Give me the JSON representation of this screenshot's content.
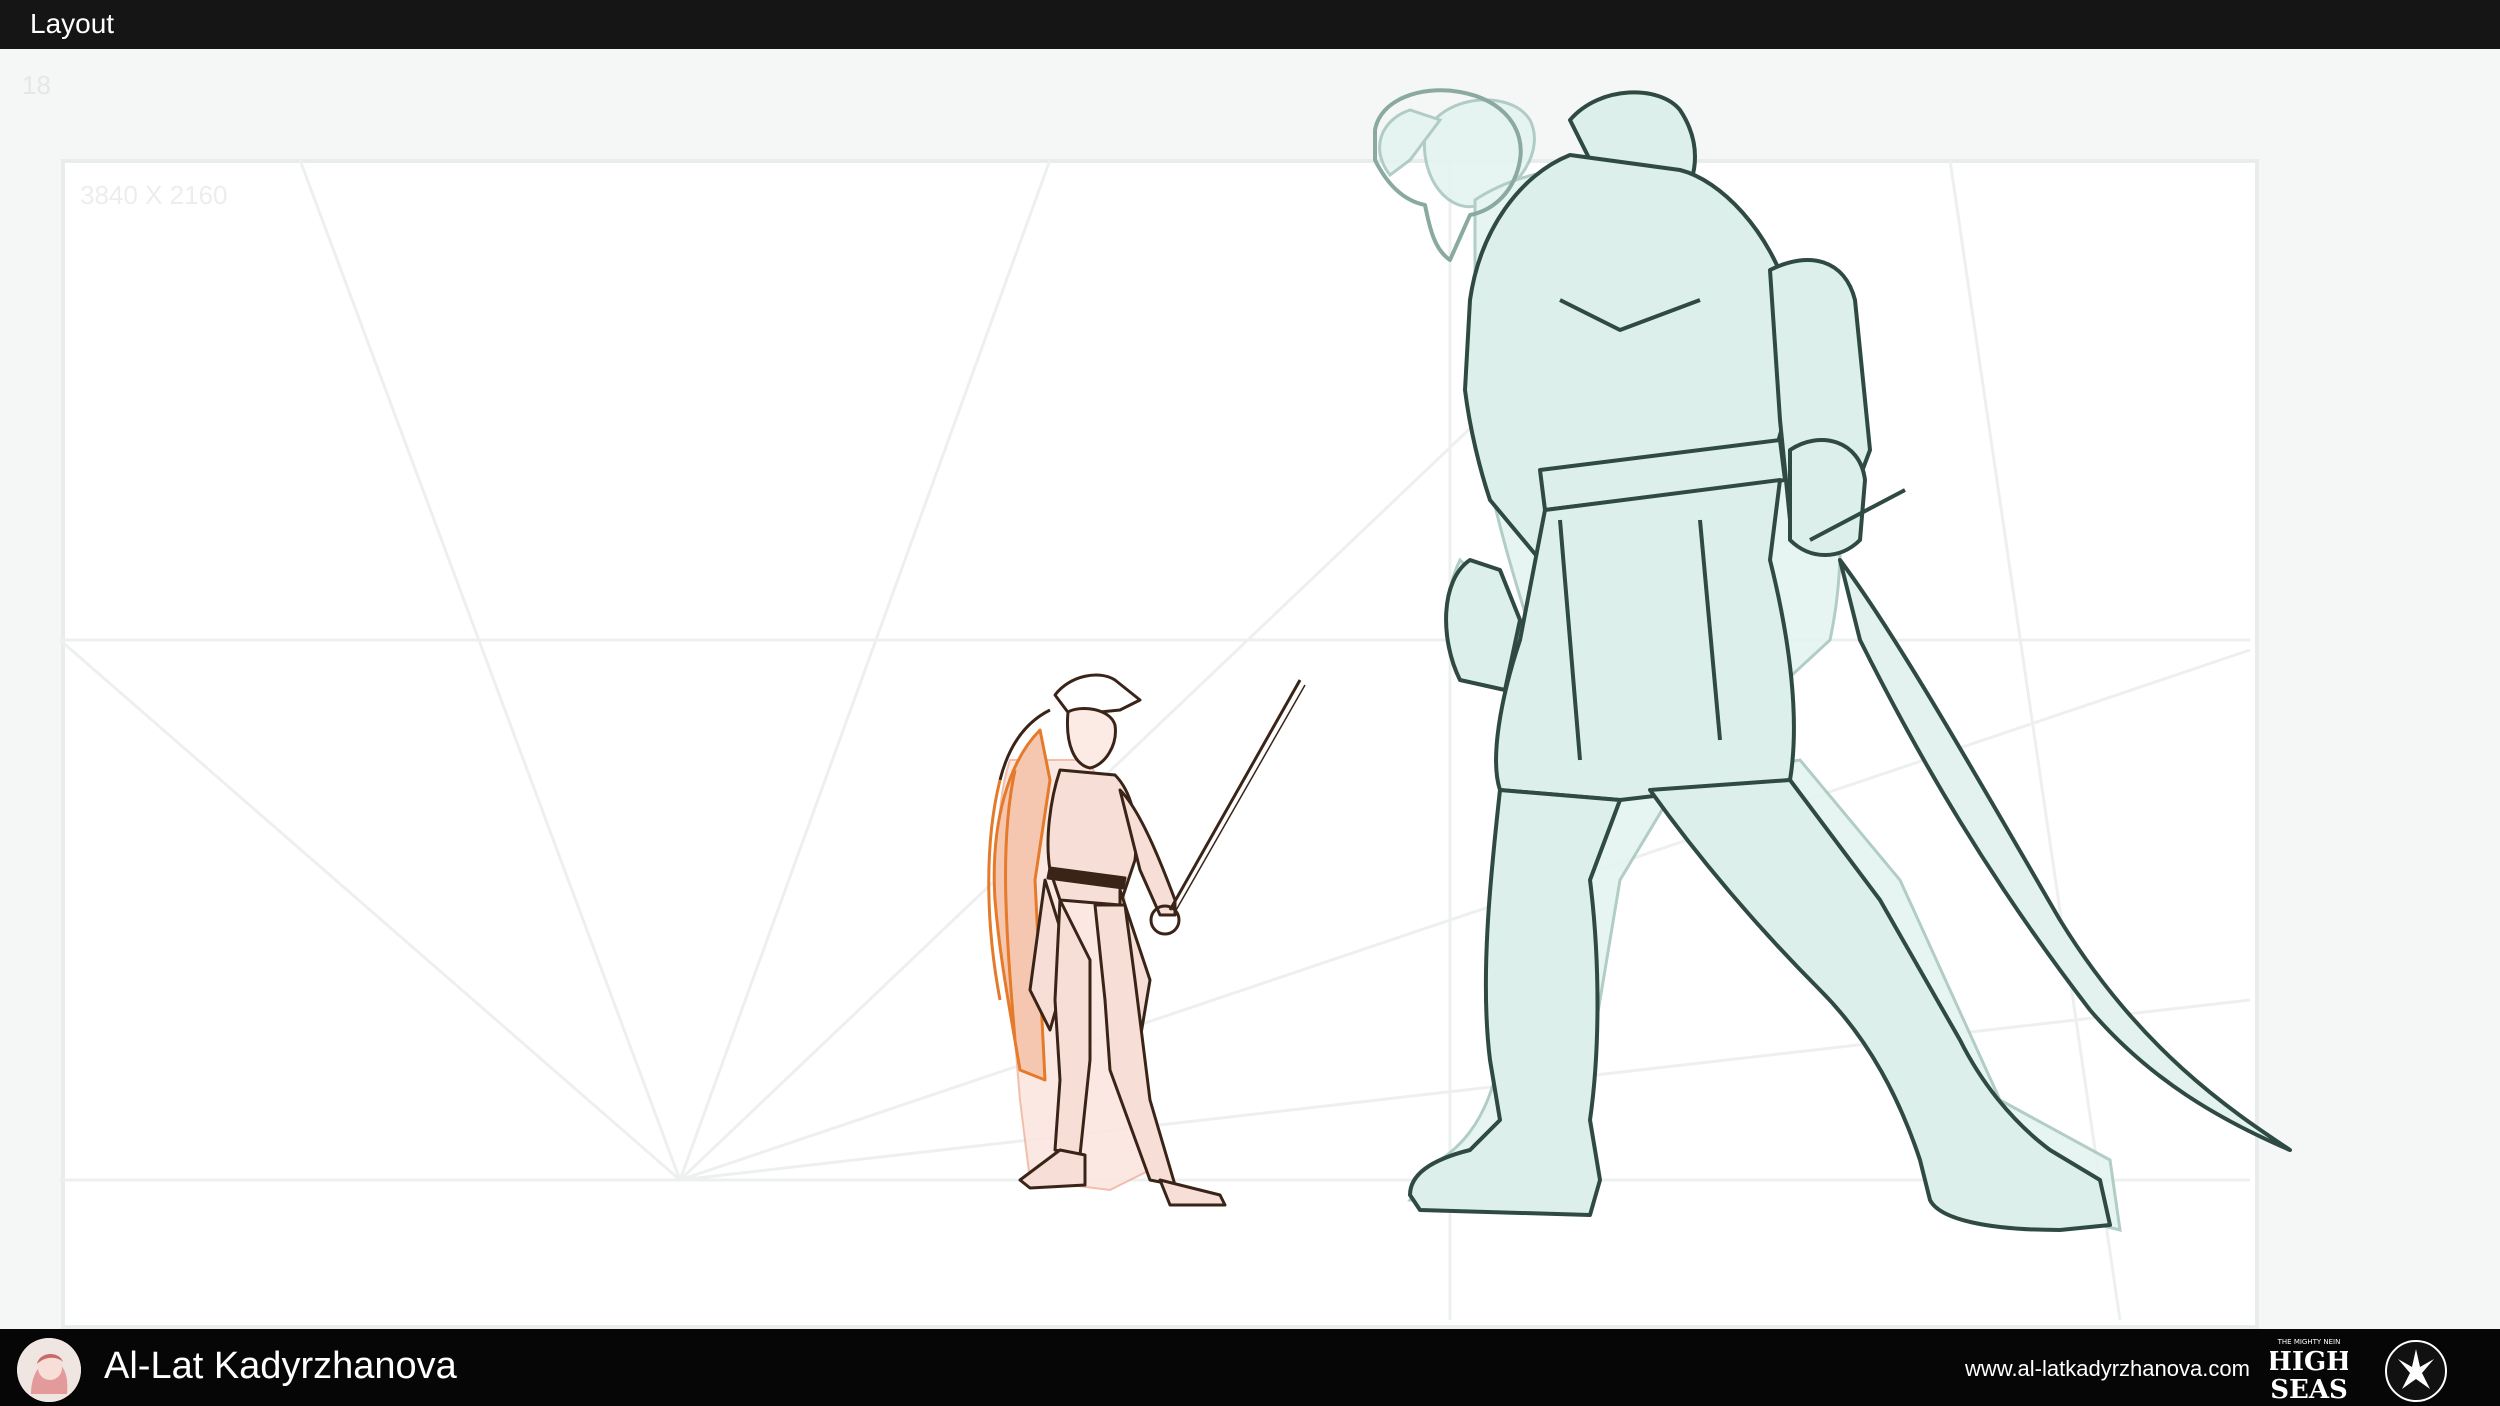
{
  "header": {
    "title": "Layout"
  },
  "workspace": {
    "frame_number": "18",
    "canvas_resolution": "3840 X 2160"
  },
  "footer": {
    "author": "Al-Lat Kadyrzhanova",
    "website": "www.al-latkadyrzhanova.com",
    "logo_highseas": {
      "line1": "HIGH",
      "line2": "SEAS",
      "small": "THE MIGHTY NEIN"
    },
    "avatar": "author-avatar"
  },
  "colors": {
    "top_bar": "#151515",
    "bottom_bar": "#060606",
    "workspace": "#f5f6f6",
    "canvas": "#ffffff",
    "giant_fill": "#dcefeb",
    "giant_line": "#2f4a42",
    "girl_fill": "#f7ded6",
    "girl_line": "#3a2418",
    "girl_hair": "#e47a2a"
  }
}
